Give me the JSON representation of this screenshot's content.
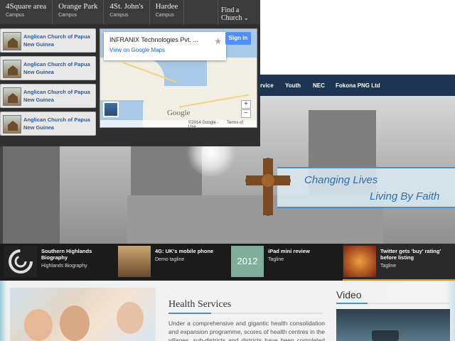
{
  "campuses": [
    {
      "name": "4Square area",
      "sub": "Campus"
    },
    {
      "name": "Orange Park",
      "sub": "Campus"
    },
    {
      "name": "4St. John's",
      "sub": "Campus"
    },
    {
      "name": "Hardee",
      "sub": "Campus"
    }
  ],
  "find_church": {
    "label": "Find a Church"
  },
  "churches": [
    {
      "name": "Anglican Church of Papua New Guinea"
    },
    {
      "name": "Anglican Church of Papua New Guinea"
    },
    {
      "name": "Anglican Church of Papua New Guinea"
    },
    {
      "name": "Anglican Church of Papua New Guinea"
    }
  ],
  "map": {
    "place": "INFRANIX Technologies Pvt. ...",
    "link": "View on Google Maps",
    "signin": "Sign in",
    "logo": "Google",
    "copyright": "©2014 Google -",
    "terms": "Terms of Use",
    "zoom_in": "+",
    "zoom_out": "−"
  },
  "nav": {
    "items": [
      "rvice",
      "Youth",
      "NEC",
      "Fokona PNG Ltd"
    ]
  },
  "hero": {
    "line1": "Changing Lives",
    "line2": "Living By Faith"
  },
  "thumbs": [
    {
      "title": "Southern Highlands Biography",
      "sub": "Highlands Biography",
      "icon": "circle-logo-icon"
    },
    {
      "title": "4G: UK's mobile phone",
      "sub": "Demo tagline",
      "icon": "people-photo"
    },
    {
      "title": "iPad mini review",
      "sub": "Tagline",
      "icon": "2012-photo",
      "badge": "2012"
    },
    {
      "title": "Twitter gets 'buy' rating' before listing",
      "sub": "Tagline",
      "icon": "fire-photo"
    }
  ],
  "health": {
    "title": "Health Services",
    "text": "Under a comprehensive and gigantic health consolidation and expansion programme, scores of health centres in the villages, sub-districts and districts have been completed and"
  },
  "video": {
    "title": "Video"
  },
  "colors": {
    "nav": "#1d3550",
    "accent": "#4a90c8",
    "tagline": "#2a6fb0",
    "active_underline": "#e88a1a"
  }
}
